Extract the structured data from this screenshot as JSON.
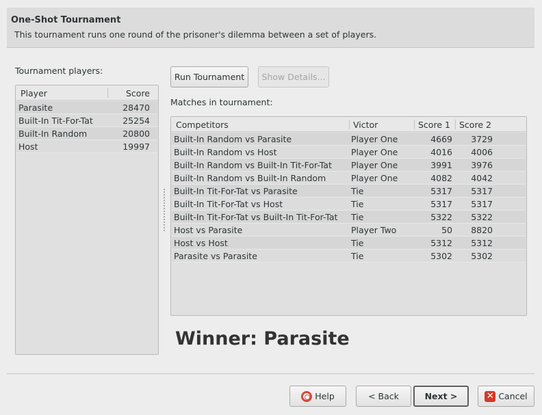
{
  "header": {
    "title": "One-Shot Tournament",
    "description": "This tournament runs one round of the prisoner's dilemma between a set of players."
  },
  "players": {
    "label": "Tournament players:",
    "columns": [
      "Player",
      "Score"
    ],
    "rows": [
      {
        "name": "Parasite",
        "score": "28470"
      },
      {
        "name": "Built-In Tit-For-Tat",
        "score": "25254"
      },
      {
        "name": "Built-In Random",
        "score": "20800"
      },
      {
        "name": "Host",
        "score": "19997"
      }
    ]
  },
  "actions": {
    "run_label": "Run Tournament",
    "details_label": "Show Details..."
  },
  "matches": {
    "label": "Matches in tournament:",
    "columns": [
      "Competitors",
      "Victor",
      "Score 1",
      "Score 2"
    ],
    "rows": [
      {
        "competitors": "Built-In Random vs Parasite",
        "victor": "Player One",
        "score1": "4669",
        "score2": "3729"
      },
      {
        "competitors": "Built-In Random vs Host",
        "victor": "Player One",
        "score1": "4016",
        "score2": "4006"
      },
      {
        "competitors": "Built-In Random vs Built-In Tit-For-Tat",
        "victor": "Player One",
        "score1": "3991",
        "score2": "3976"
      },
      {
        "competitors": "Built-In Random vs Built-In Random",
        "victor": "Player One",
        "score1": "4082",
        "score2": "4042"
      },
      {
        "competitors": "Built-In Tit-For-Tat vs Parasite",
        "victor": "Tie",
        "score1": "5317",
        "score2": "5317"
      },
      {
        "competitors": "Built-In Tit-For-Tat vs Host",
        "victor": "Tie",
        "score1": "5317",
        "score2": "5317"
      },
      {
        "competitors": "Built-In Tit-For-Tat vs Built-In Tit-For-Tat",
        "victor": "Tie",
        "score1": "5322",
        "score2": "5322"
      },
      {
        "competitors": "Host vs Parasite",
        "victor": "Player Two",
        "score1": "50",
        "score2": "8820"
      },
      {
        "competitors": "Host vs Host",
        "victor": "Tie",
        "score1": "5312",
        "score2": "5312"
      },
      {
        "competitors": "Parasite vs Parasite",
        "victor": "Tie",
        "score1": "5302",
        "score2": "5302"
      }
    ]
  },
  "winner": "Winner: Parasite",
  "footer": {
    "help": "Help",
    "back": "< Back",
    "next": "Next >",
    "cancel": "Cancel"
  }
}
